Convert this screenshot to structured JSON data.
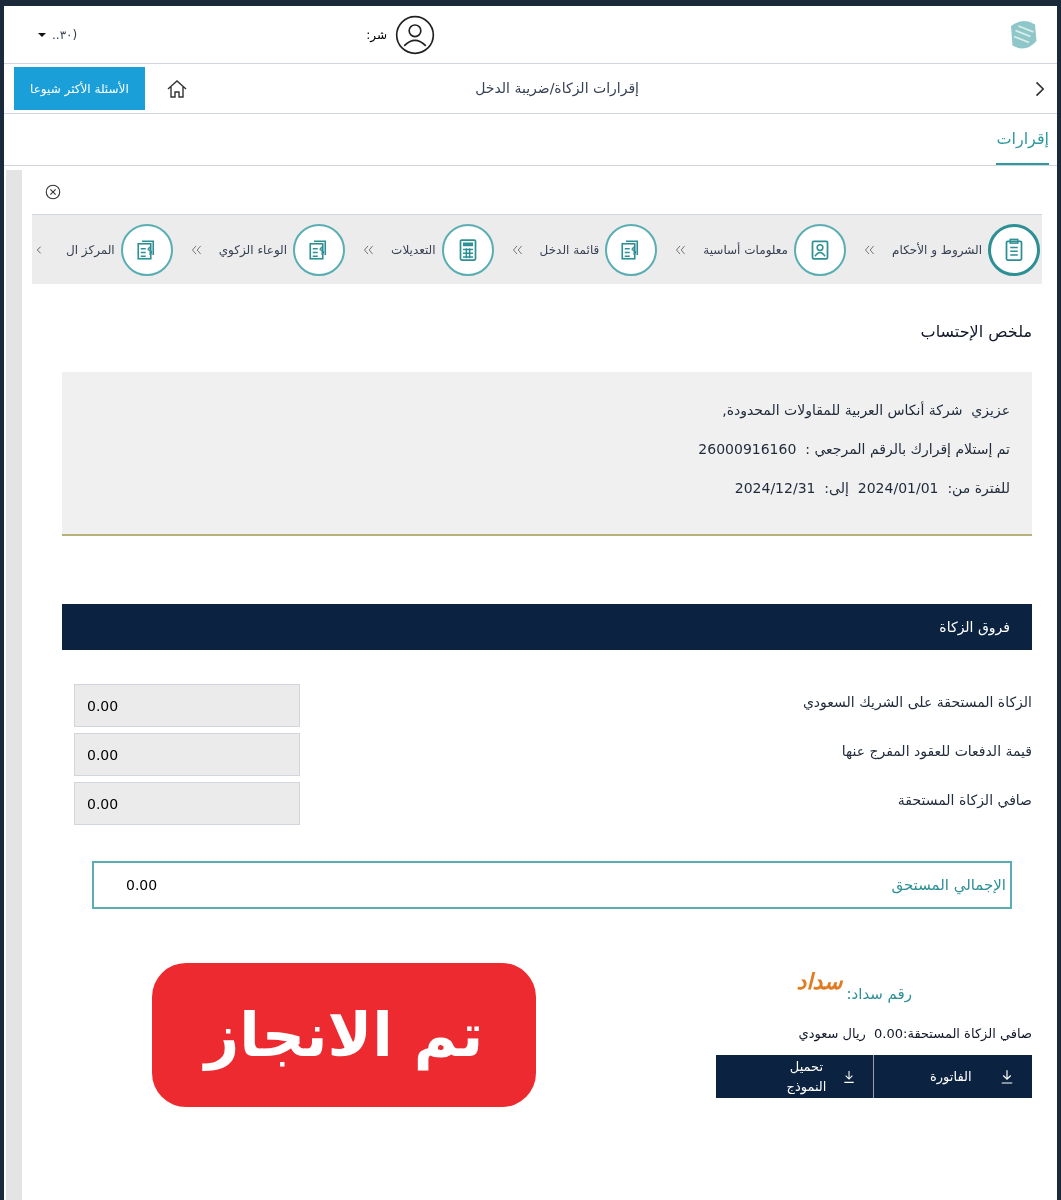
{
  "header": {
    "account_text": "(٣٠..",
    "user_label": "شر:"
  },
  "breadcrumb": {
    "title": "إقرارات الزكاة/ضريبة الدخل",
    "faq_button": "الأسئلة الأكثر شيوعا"
  },
  "section_tab": {
    "label": "إقرارات",
    "selected": true
  },
  "steps": [
    {
      "kind": "clipboard",
      "label": "الشروط و الأحكام",
      "selected": true
    },
    {
      "kind": "person",
      "label": "معلومات أساسية",
      "selected": false
    },
    {
      "kind": "invoice",
      "label": "قائمة الدخل",
      "selected": false
    },
    {
      "kind": "calculator",
      "label": "التعديلات",
      "selected": false
    },
    {
      "kind": "invoice",
      "label": "الوعاء الزكوي",
      "selected": false
    },
    {
      "kind": "invoice",
      "label": "المركز ال",
      "selected": false
    }
  ],
  "summary": {
    "title": "ملخص الإحتساب",
    "lines": [
      "عزيزي  شركة أنكاس العربية للمقاولات المحدودة,",
      "تم إستلام إقرارك بالرقم المرجعي :  26000916160",
      "للفترة من:  2024/01/01  إلى:  2024/12/31"
    ]
  },
  "zakat_diff": {
    "title": "فروق الزكاة",
    "fields": [
      {
        "label": "الزكاة المستحقة على الشريك السعودي",
        "value": "0.00"
      },
      {
        "label": "قيمة الدفعات للعقود المفرج عنها",
        "value": "0.00"
      },
      {
        "label": "صافي الزكاة المستحقة",
        "value": "0.00"
      }
    ],
    "total_label": "الإجمالي المستحق",
    "total_value": "0.00"
  },
  "stamp": "تم الانجاز",
  "payment": {
    "logo": "سداد",
    "sadad_label": "رقم سداد:",
    "net_line": "صافي الزكاة المستحقة:0.00  ريال سعودي",
    "buttons": [
      "الفاتورة",
      "تحميل النموذج"
    ]
  }
}
